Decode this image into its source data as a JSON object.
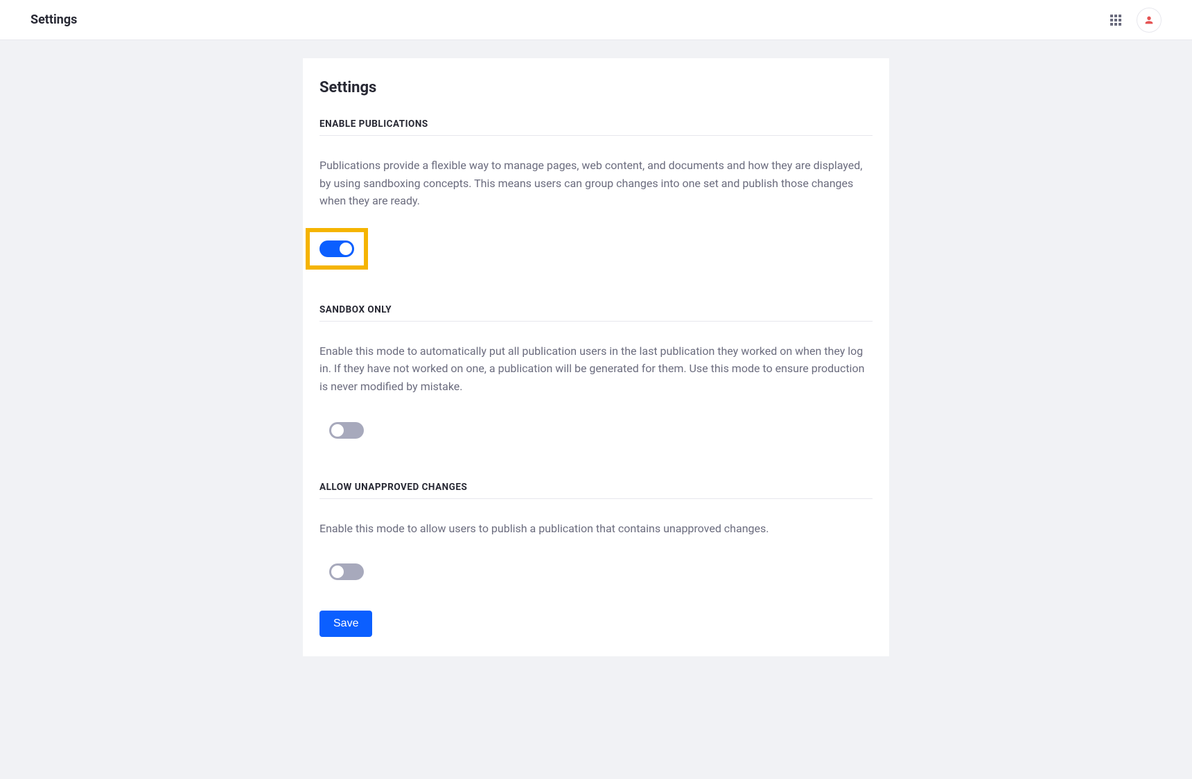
{
  "header": {
    "title": "Settings"
  },
  "card": {
    "title": "Settings",
    "sections": [
      {
        "heading": "ENABLE PUBLICATIONS",
        "description": "Publications provide a flexible way to manage pages, web content, and documents and how they are displayed, by using sandboxing concepts. This means users can group changes into one set and publish those changes when they are ready.",
        "toggle_on": true,
        "highlighted": true
      },
      {
        "heading": "SANDBOX ONLY",
        "description": "Enable this mode to automatically put all publication users in the last publication they worked on when they log in. If they have not worked on one, a publication will be generated for them. Use this mode to ensure production is never modified by mistake.",
        "toggle_on": false,
        "highlighted": false
      },
      {
        "heading": "ALLOW UNAPPROVED CHANGES",
        "description": "Enable this mode to allow users to publish a publication that contains unapproved changes.",
        "toggle_on": false,
        "highlighted": false
      }
    ],
    "save_label": "Save"
  }
}
